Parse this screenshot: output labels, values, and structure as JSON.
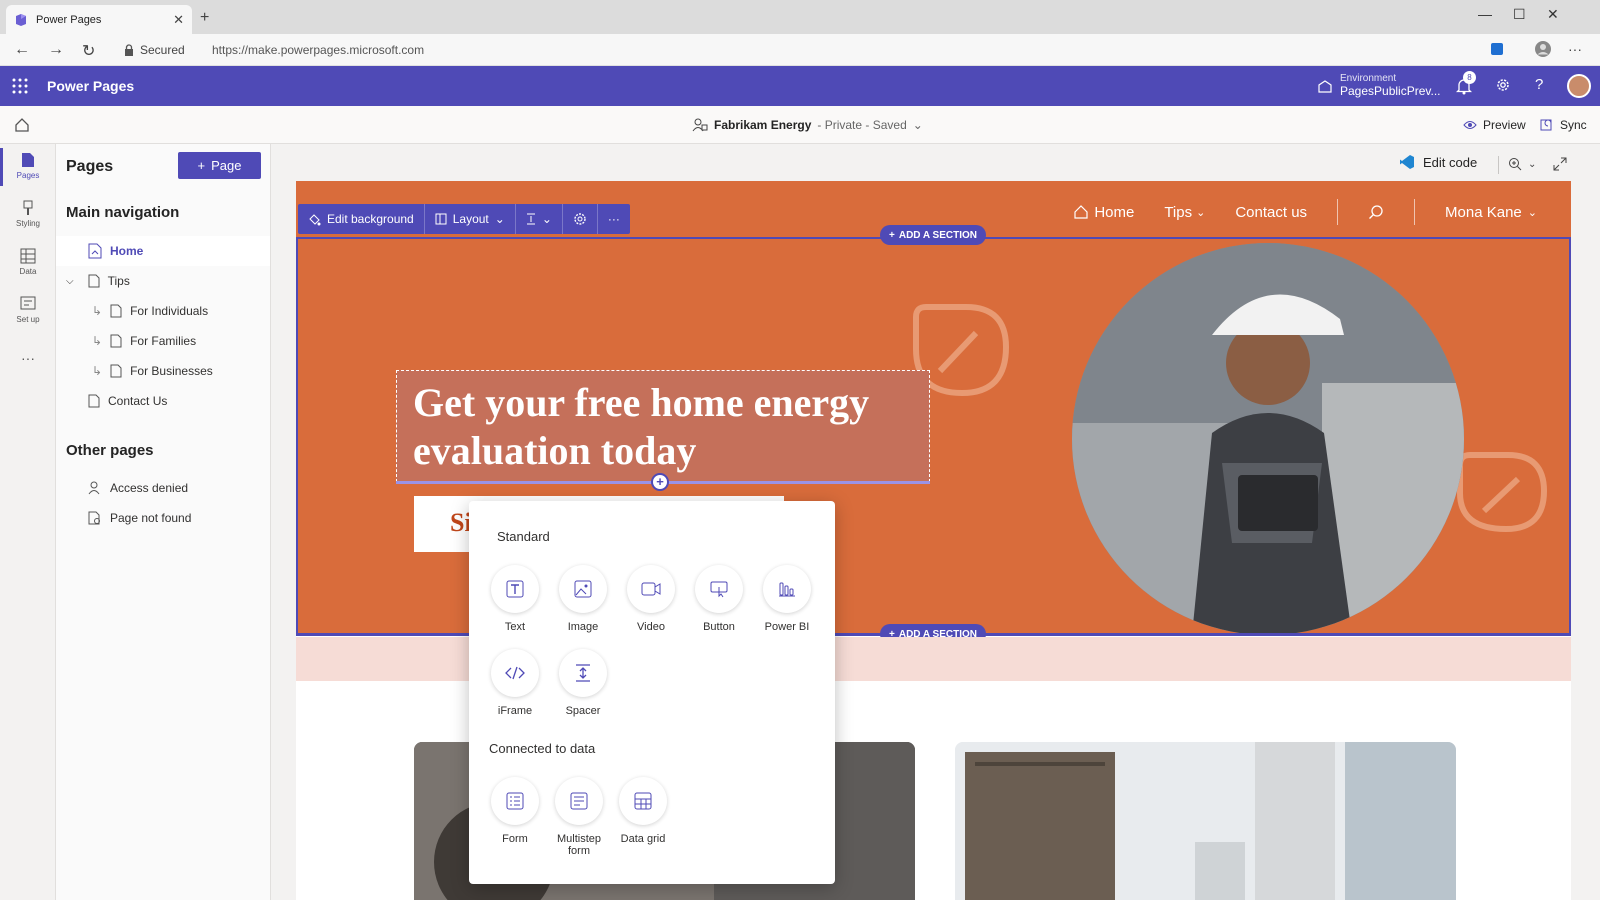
{
  "browser": {
    "tab_title": "Power Pages",
    "close": "✕",
    "new_tab": "+",
    "secured": "Secured",
    "url": "https://make.powerpages.microsoft.com",
    "window_minimize": "—",
    "window_maximize": "☐",
    "window_close": "✕",
    "more": "···"
  },
  "app": {
    "title": "Power Pages",
    "environment_label": "Environment",
    "environment_value": "PagesPublicPrev...",
    "notification_count": "8",
    "help": "?"
  },
  "subbar": {
    "site_name": "Fabrikam Energy",
    "site_status": "- Private - Saved",
    "preview": "Preview",
    "sync": "Sync"
  },
  "rail": {
    "items": [
      {
        "label": "Pages"
      },
      {
        "label": "Styling"
      },
      {
        "label": "Data"
      },
      {
        "label": "Set up"
      }
    ],
    "more": "···"
  },
  "panel": {
    "title": "Pages",
    "add_page": "Page",
    "main_nav_title": "Main navigation",
    "main_nav": [
      {
        "label": "Home"
      },
      {
        "label": "Tips"
      },
      {
        "label": "For Individuals"
      },
      {
        "label": "For Families"
      },
      {
        "label": "For Businesses"
      },
      {
        "label": "Contact Us"
      }
    ],
    "other_title": "Other pages",
    "other": [
      {
        "label": "Access denied"
      },
      {
        "label": "Page not found"
      }
    ]
  },
  "canvas": {
    "edit_code": "Edit code"
  },
  "site": {
    "nav": [
      {
        "label": "Home"
      },
      {
        "label": "Tips"
      },
      {
        "label": "Contact us"
      }
    ],
    "user": "Mona Kane",
    "toolbar": {
      "edit_background": "Edit background",
      "layout": "Layout",
      "more": "···"
    },
    "add_section": "ADD A SECTION",
    "headline": "Get your free home energy evaluation today",
    "cta_partial": "Si"
  },
  "popup": {
    "standard_title": "Standard",
    "standard": [
      {
        "label": "Text"
      },
      {
        "label": "Image"
      },
      {
        "label": "Video"
      },
      {
        "label": "Button"
      },
      {
        "label": "Power BI"
      },
      {
        "label": "iFrame"
      },
      {
        "label": "Spacer"
      }
    ],
    "data_title": "Connected to data",
    "data": [
      {
        "label": "Form"
      },
      {
        "label": "Multistep form"
      },
      {
        "label": "Data grid"
      }
    ]
  },
  "colors": {
    "brand": "#4f4ab6",
    "hero": "#d96c3b",
    "pink_band": "#f6dcd6"
  }
}
